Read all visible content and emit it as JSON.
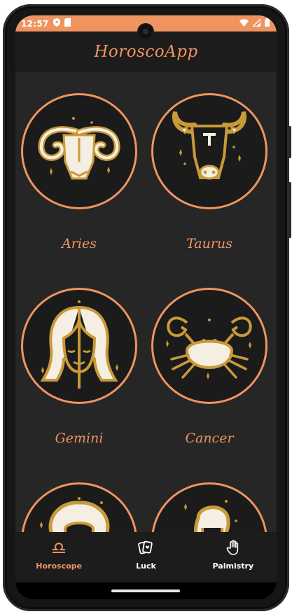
{
  "status_bar": {
    "time": "12:57",
    "left_icons": [
      "shield-icon",
      "sim-card-icon"
    ],
    "right_icons": [
      "wifi-icon",
      "signal-icon",
      "battery-icon"
    ]
  },
  "app_bar": {
    "title": "HoroscoApp"
  },
  "signs": [
    {
      "name": "Aries",
      "icon": "aries-ram-icon"
    },
    {
      "name": "Taurus",
      "icon": "taurus-bull-icon"
    },
    {
      "name": "Gemini",
      "icon": "gemini-face-icon"
    },
    {
      "name": "Cancer",
      "icon": "cancer-crab-icon"
    },
    {
      "name": "",
      "icon": "leo-lion-icon"
    },
    {
      "name": "",
      "icon": "virgo-maiden-icon"
    }
  ],
  "bottom_nav": {
    "items": [
      {
        "label": "Horoscope",
        "icon": "libra-icon",
        "active": true
      },
      {
        "label": "Luck",
        "icon": "cards-icon",
        "active": false
      },
      {
        "label": "Palmistry",
        "icon": "hand-icon",
        "active": false
      }
    ]
  },
  "colors": {
    "accent": "#ef9461",
    "gold": "#c99a3a",
    "ivory": "#f4efe2",
    "background": "#262626",
    "bar": "#1c1c1c"
  }
}
